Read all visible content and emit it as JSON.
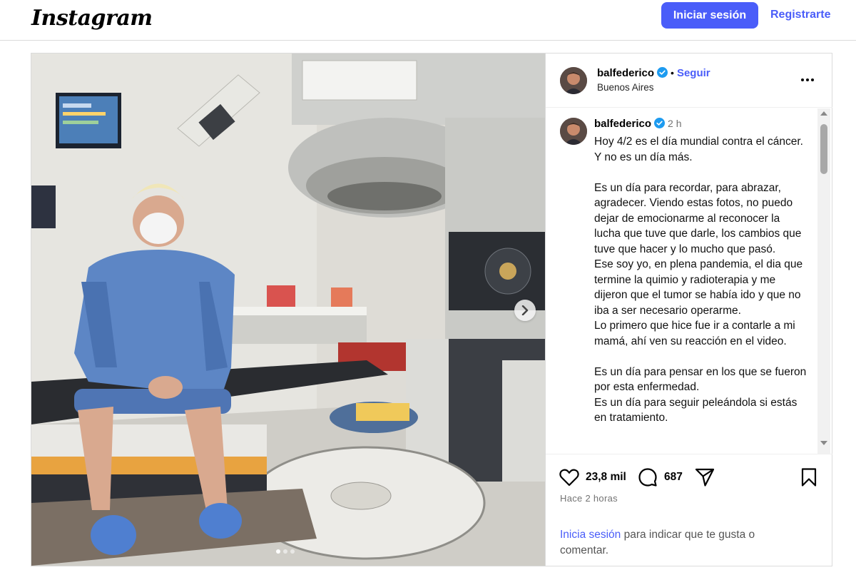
{
  "header": {
    "logo_text": "Instagram",
    "login_button": "Iniciar sesión",
    "register_link": "Registrarte"
  },
  "post": {
    "username": "balfederico",
    "follow_label": "Seguir",
    "location": "Buenos Aires",
    "caption_time": "2 h",
    "caption": "Hoy 4/2 es el día mundial contra el cáncer. Y no es un día más.\n\nEs un día para recordar, para abrazar, agradecer. Viendo estas fotos, no puedo dejar de emocionarme al reconocer la lucha que tuve que darle, los cambios que tuve que hacer y lo mucho que pasó.\nEse soy yo, en plena pandemia, el dia que termine la quimio y radioterapia y me dijeron que el tumor se había ido y que no iba a ser necesario operarme.\nLo primero que hice fue ir a contarle a mi mamá, ahí ven su reacción en el video.\n\nEs un día para pensar en los que se fueron por esta enfermedad.\nEs un día para seguir peleándola si estás en tratamiento.",
    "likes": "23,8 mil",
    "comments": "687",
    "posted_ago": "Hace 2 horas",
    "login_note_link": "Inicia sesión",
    "login_note_rest": " para indicar que te gusta o comentar.",
    "carousel_total": 3,
    "carousel_current": 1
  },
  "icons": {
    "verified": "verified-badge-icon",
    "more": "more-options-icon",
    "like": "heart-icon",
    "comment": "comment-icon",
    "share": "share-icon",
    "save": "bookmark-icon",
    "next": "chevron-right-icon"
  },
  "colors": {
    "accent": "#4a5df9",
    "verified": "#1d9bf0",
    "muted": "#737373"
  }
}
